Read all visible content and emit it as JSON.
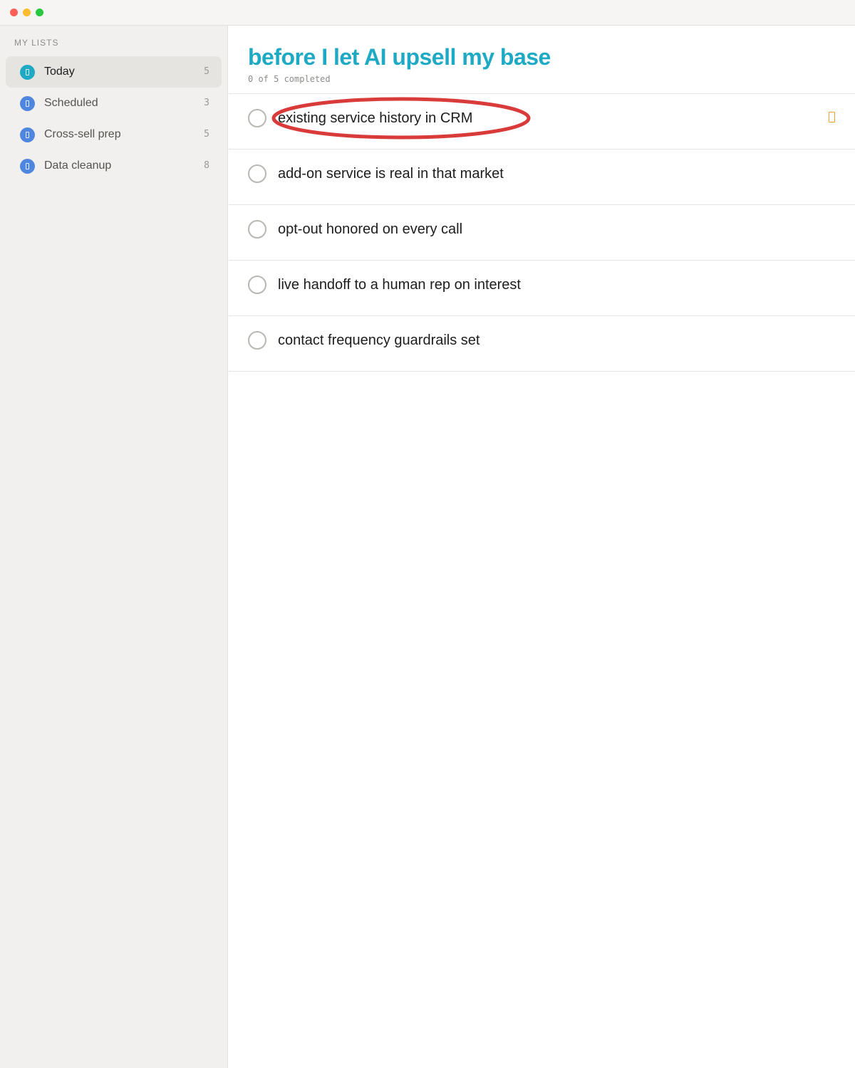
{
  "window": {
    "controls": [
      "close",
      "minimize",
      "maximize"
    ]
  },
  "sidebar": {
    "heading": "MY LISTS",
    "items": [
      {
        "label": "Today",
        "count": "5",
        "color": "#1eaac4",
        "icon": "list-icon",
        "active": true
      },
      {
        "label": "Scheduled",
        "count": "3",
        "color": "#4f86e0",
        "icon": "list-icon",
        "active": false
      },
      {
        "label": "Cross-sell prep",
        "count": "5",
        "color": "#4f86e0",
        "icon": "list-icon",
        "active": false
      },
      {
        "label": "Data cleanup",
        "count": "8",
        "color": "#4f86e0",
        "icon": "list-icon",
        "active": false
      }
    ]
  },
  "main": {
    "title": "before I let AI upsell my base",
    "title_color": "#1eaac4",
    "progress": "0 of 5 completed",
    "completed": 0,
    "total": 5,
    "tasks": [
      {
        "text": "existing service history in CRM",
        "done": false,
        "flagged": true,
        "highlighted": true
      },
      {
        "text": "add-on service is real in that market",
        "done": false,
        "flagged": false
      },
      {
        "text": "opt-out honored on every call",
        "done": false,
        "flagged": false
      },
      {
        "text": "live handoff to a human rep on interest",
        "done": false,
        "flagged": false
      },
      {
        "text": "contact frequency guardrails set",
        "done": false,
        "flagged": false
      }
    ],
    "flag_color": "#f0a22e",
    "annotation_color": "#d93a3a"
  }
}
